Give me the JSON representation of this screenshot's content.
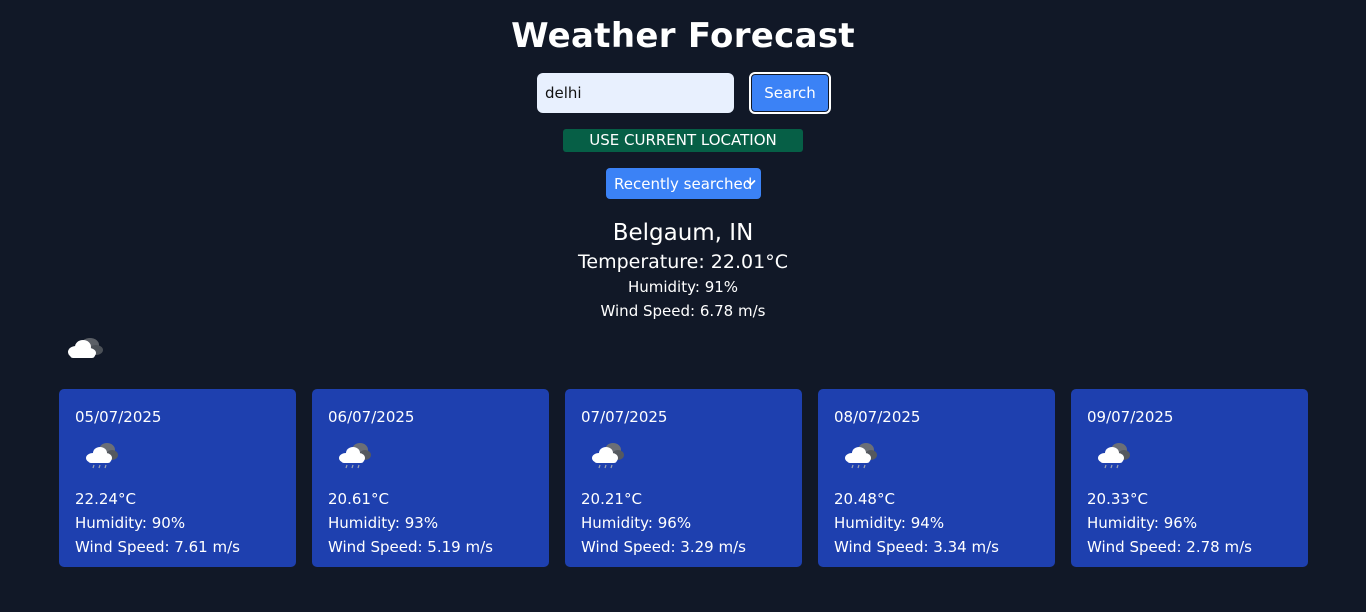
{
  "title": "Weather Forecast",
  "search": {
    "value": "delhi",
    "button_label": "Search"
  },
  "location_button": "USE CURRENT LOCATION",
  "recent": {
    "selected": "Recently searched"
  },
  "current": {
    "city": "Belgaum, IN",
    "temperature": "Temperature: 22.01°C",
    "humidity": "Humidity: 91%",
    "wind": "Wind Speed: 6.78 m/s",
    "icon": "cloud-icon"
  },
  "forecast": [
    {
      "date": "05/07/2025",
      "temp": "22.24°C",
      "humidity": "Humidity: 90%",
      "wind": "Wind Speed: 7.61 m/s",
      "icon": "cloud-icon"
    },
    {
      "date": "06/07/2025",
      "temp": "20.61°C",
      "humidity": "Humidity: 93%",
      "wind": "Wind Speed: 5.19 m/s",
      "icon": "cloud-icon"
    },
    {
      "date": "07/07/2025",
      "temp": "20.21°C",
      "humidity": "Humidity: 96%",
      "wind": "Wind Speed: 3.29 m/s",
      "icon": "cloud-icon"
    },
    {
      "date": "08/07/2025",
      "temp": "20.48°C",
      "humidity": "Humidity: 94%",
      "wind": "Wind Speed: 3.34 m/s",
      "icon": "cloud-icon"
    },
    {
      "date": "09/07/2025",
      "temp": "20.33°C",
      "humidity": "Humidity: 96%",
      "wind": "Wind Speed: 2.78 m/s",
      "icon": "cloud-icon"
    }
  ],
  "colors": {
    "background": "#111827",
    "primary": "#3b82f6",
    "card": "#1e40af",
    "location": "#065f46"
  }
}
